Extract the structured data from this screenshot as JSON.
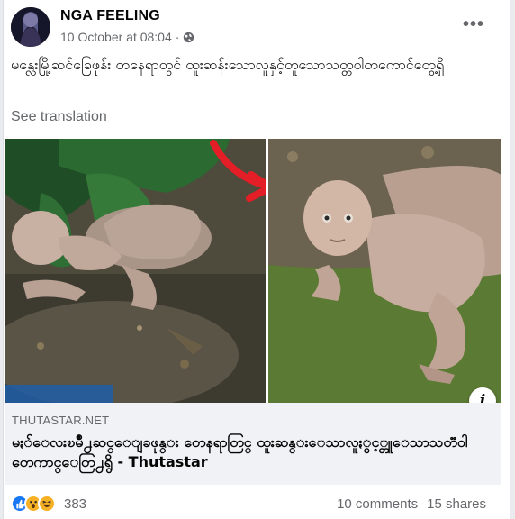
{
  "post": {
    "author": "NGA FEELING",
    "timestamp": "10 October at 08:04",
    "separator": "·",
    "audience_icon": "globe-icon",
    "menu_label": "•••",
    "text": "မန္လေးမြို့ဆင်ခြေဖုန်း တနေရာတွင် ထူးဆန်းသောလူနှင့်တူသောသတ္တဝါတကောင်တွေ့ရှိ",
    "see_translation": "See translation"
  },
  "link": {
    "domain": "THUTASTAR.NET",
    "title": "မႏၲေလးၿမိဳ႕ဆင္ေျခဖုန္း တေနရာတြင္ ထူးဆန္းေသာလူႏွင့္တူေသာသတၱ၀ါတေကာင္ေတြ႕ရွိ - Thutastar",
    "info_icon": "i"
  },
  "footer": {
    "reaction_icons": [
      "like-icon",
      "wow-icon",
      "haha-icon"
    ],
    "reaction_count": "383",
    "comments": "10 comments",
    "shares": "15 shares"
  },
  "colors": {
    "like": "#1877f2",
    "wow": "#f7b125",
    "haha": "#f7b125",
    "arrow": "#e41e26",
    "secondary_text": "#65676b"
  }
}
